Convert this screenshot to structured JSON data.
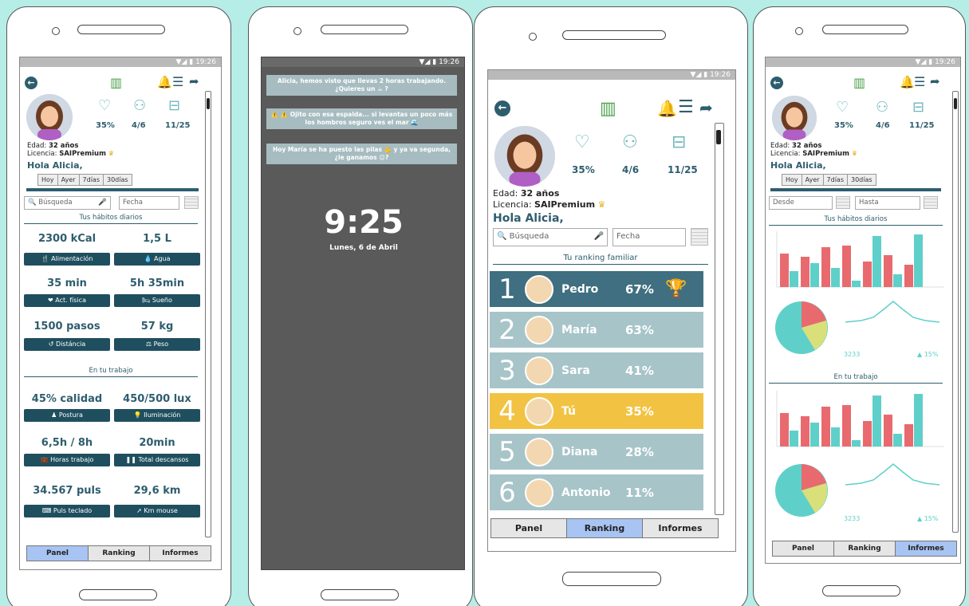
{
  "status": {
    "time": "19:26"
  },
  "colors": {
    "background": "#b6ede6",
    "primary": "#2e5d6e",
    "rank_row": "#a7c4c9",
    "rank_top": "#3f6f80",
    "rank_you": "#f2c342",
    "bar_red": "#e86a6f",
    "bar_teal": "#5fd0c9",
    "nav_active": "#a7c4f2"
  },
  "panel": {
    "age_label": "Edad:",
    "age": "32 años",
    "license_label": "Licencia:",
    "license": "SAIPremium",
    "greeting": "Hola Alicia,",
    "stats": [
      "35%",
      "4/6",
      "11/25"
    ],
    "tabs": [
      "Hoy",
      "Ayer",
      "7días",
      "30días"
    ],
    "search_placeholder": "Búsqueda",
    "date_placeholder": "Fecha",
    "habits_title": "Tus hábitos diarios",
    "habits": [
      {
        "value": "2300 kCal",
        "label": "Alimentación",
        "icon": "cutlery-icon"
      },
      {
        "value": "1,5 L",
        "label": "Agua",
        "icon": "drop-icon"
      },
      {
        "value": "35 min",
        "label": "Act. física",
        "icon": "heart-icon"
      },
      {
        "value": "5h 35min",
        "label": "Sueño",
        "icon": "bed-icon"
      },
      {
        "value": "1500 pasos",
        "label": "Distáncia",
        "icon": "history-icon"
      },
      {
        "value": "57 kg",
        "label": "Peso",
        "icon": "scale-icon"
      }
    ],
    "work_title": "En tu trabajo",
    "work": [
      {
        "value": "45% calidad",
        "label": "Postura",
        "icon": "person-icon"
      },
      {
        "value": "450/500 lux",
        "label": "Iluminación",
        "icon": "bulb-icon"
      },
      {
        "value": "6,5h / 8h",
        "label": "Horas trabajo",
        "icon": "briefcase-icon"
      },
      {
        "value": "20min",
        "label": "Total descansos",
        "icon": "pause-icon"
      },
      {
        "value": "34.567 puls",
        "label": "Puls teclado",
        "icon": "keyboard-icon"
      },
      {
        "value": "29,6 km",
        "label": "Km mouse",
        "icon": "cursor-icon"
      }
    ]
  },
  "nav": [
    "Panel",
    "Ranking",
    "Informes"
  ],
  "lock": {
    "notifications": [
      "Alicia, hemos visto que llevas 2 horas trabajando. ¿Quieres un ☕ ?",
      "⚠️ ⚠️ Ojito con esa espalda... si levantas un poco más los hombros seguro ves el mar 🌊",
      "Hoy María se ha puesto las pilas 💪 y ya va segunda, ¿le ganamos 😉?"
    ],
    "time": "9:25",
    "date": "Lunes, 6 de Abril"
  },
  "ranking": {
    "title": "Tu ranking familiar",
    "rows": [
      {
        "pos": "1",
        "name": "Pedro",
        "pct": "67%"
      },
      {
        "pos": "2",
        "name": "María",
        "pct": "63%"
      },
      {
        "pos": "3",
        "name": "Sara",
        "pct": "41%"
      },
      {
        "pos": "4",
        "name": "Tú",
        "pct": "35%"
      },
      {
        "pos": "5",
        "name": "Diana",
        "pct": "28%"
      },
      {
        "pos": "6",
        "name": "Antonio",
        "pct": "11%"
      }
    ]
  },
  "informes": {
    "from_placeholder": "Desde",
    "to_placeholder": "Hasta",
    "habits_title": "Tus hábitos diarios",
    "work_title": "En tu trabajo",
    "line_value": "3233",
    "line_change": "15%"
  }
}
